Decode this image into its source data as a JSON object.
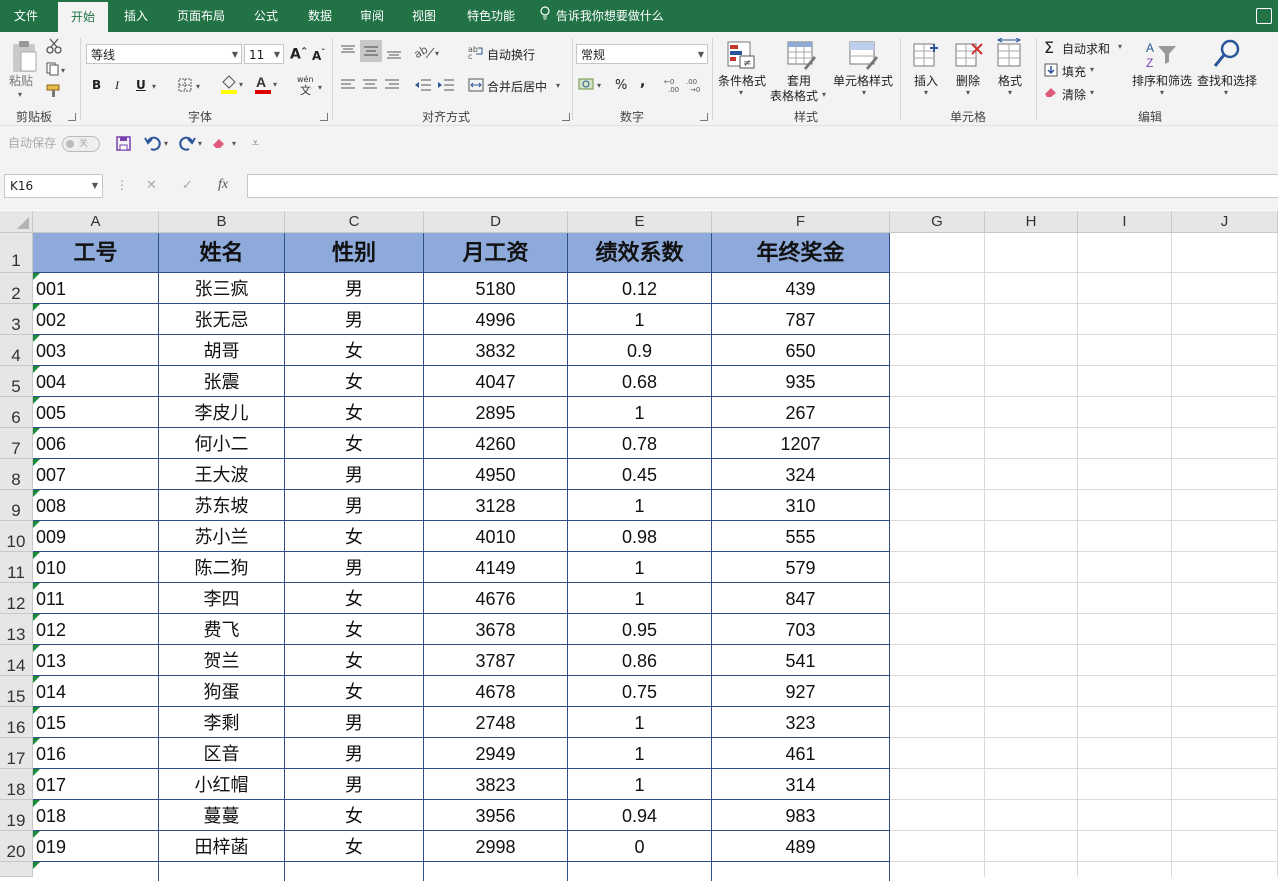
{
  "tabs": [
    {
      "label": "文件",
      "active": false
    },
    {
      "label": "开始",
      "active": true
    },
    {
      "label": "插入",
      "active": false
    },
    {
      "label": "页面布局",
      "active": false
    },
    {
      "label": "公式",
      "active": false
    },
    {
      "label": "数据",
      "active": false
    },
    {
      "label": "审阅",
      "active": false
    },
    {
      "label": "视图",
      "active": false
    },
    {
      "label": "特色功能",
      "active": false
    }
  ],
  "tell_me": "告诉我你想要做什么",
  "ribbon": {
    "clipboard": {
      "paste": "粘贴",
      "group": "剪贴板"
    },
    "font": {
      "name": "等线",
      "size": "11",
      "group": "字体",
      "bold": "B",
      "italic": "I",
      "underline": "U"
    },
    "alignment": {
      "wrap": "自动换行",
      "merge": "合并后居中",
      "group": "对齐方式"
    },
    "number": {
      "format": "常规",
      "percent": "%",
      "comma": ",",
      "group": "数字"
    },
    "styles": {
      "conditional": "条件格式",
      "table": "套用\n表格格式",
      "table_l1": "套用",
      "table_l2": "表格格式",
      "cell": "单元格样式",
      "group": "样式"
    },
    "cells": {
      "insert": "插入",
      "delete": "删除",
      "format": "格式",
      "group": "单元格"
    },
    "editing": {
      "autosum": "自动求和",
      "fill": "填充",
      "clear": "清除",
      "sort": "排序和筛选",
      "find": "查找和选择",
      "group": "编辑"
    }
  },
  "qat": {
    "autosave": "自动保存",
    "autosave_state": "关"
  },
  "formula_bar": {
    "name_box": "K16",
    "cancel": "✕",
    "enter": "✓",
    "fx": "fx",
    "formula": ""
  },
  "colors": {
    "accent": "#217346",
    "header_fill": "#8eaadb",
    "border": "#2f4f8a"
  },
  "columns": [
    "A",
    "B",
    "C",
    "D",
    "E",
    "F",
    "G",
    "H",
    "I",
    "J"
  ],
  "table": {
    "headers": [
      "工号",
      "姓名",
      "性别",
      "月工资",
      "绩效系数",
      "年终奖金"
    ],
    "rows": [
      [
        "001",
        "张三疯",
        "男",
        "5180",
        "0.12",
        "439"
      ],
      [
        "002",
        "张无忌",
        "男",
        "4996",
        "1",
        "787"
      ],
      [
        "003",
        "胡哥",
        "女",
        "3832",
        "0.9",
        "650"
      ],
      [
        "004",
        "张震",
        "女",
        "4047",
        "0.68",
        "935"
      ],
      [
        "005",
        "李皮儿",
        "女",
        "2895",
        "1",
        "267"
      ],
      [
        "006",
        "何小二",
        "女",
        "4260",
        "0.78",
        "1207"
      ],
      [
        "007",
        "王大波",
        "男",
        "4950",
        "0.45",
        "324"
      ],
      [
        "008",
        "苏东坡",
        "男",
        "3128",
        "1",
        "310"
      ],
      [
        "009",
        "苏小兰",
        "女",
        "4010",
        "0.98",
        "555"
      ],
      [
        "010",
        "陈二狗",
        "男",
        "4149",
        "1",
        "579"
      ],
      [
        "011",
        "李四",
        "女",
        "4676",
        "1",
        "847"
      ],
      [
        "012",
        "费飞",
        "女",
        "3678",
        "0.95",
        "703"
      ],
      [
        "013",
        "贺兰",
        "女",
        "3787",
        "0.86",
        "541"
      ],
      [
        "014",
        "狗蛋",
        "女",
        "4678",
        "0.75",
        "927"
      ],
      [
        "015",
        "李剩",
        "男",
        "2748",
        "1",
        "323"
      ],
      [
        "016",
        "区音",
        "男",
        "2949",
        "1",
        "461"
      ],
      [
        "017",
        "小红帽",
        "男",
        "3823",
        "1",
        "314"
      ],
      [
        "018",
        "蔓蔓",
        "女",
        "3956",
        "0.94",
        "983"
      ],
      [
        "019",
        "田梓菡",
        "女",
        "2998",
        "0",
        "489"
      ]
    ]
  },
  "row_numbers": [
    "1",
    "2",
    "3",
    "4",
    "5",
    "6",
    "7",
    "8",
    "9",
    "10",
    "11",
    "12",
    "13",
    "14",
    "15",
    "16",
    "17",
    "18",
    "19",
    "20"
  ]
}
